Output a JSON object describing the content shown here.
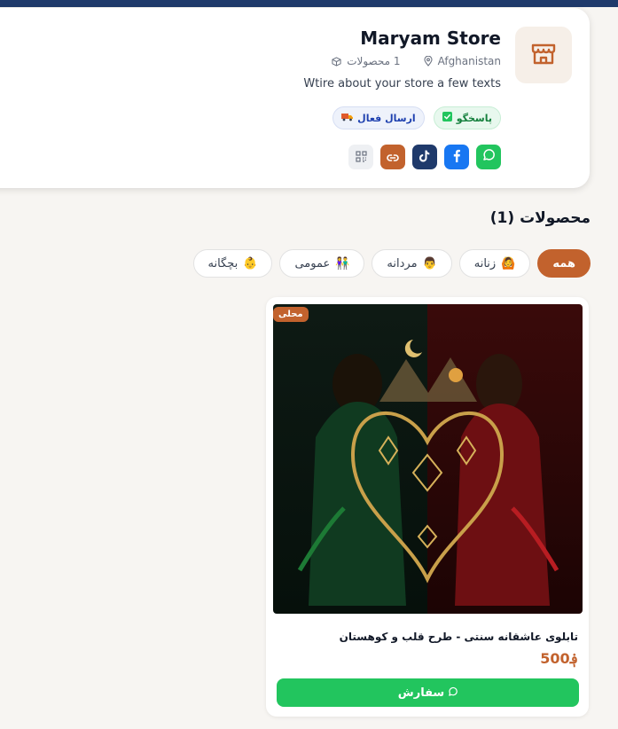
{
  "colors": {
    "accent": "#c2622d",
    "primary": "#1f3a6b",
    "success": "#22c55e"
  },
  "store": {
    "name": "Maryam Store",
    "location": "Afghanistan",
    "product_count": "1 محصولات",
    "description": "Wtire about your store a few texts",
    "badges": [
      {
        "icon": "check-box-icon",
        "label": "پاسخگو"
      },
      {
        "icon": "truck-icon",
        "label": "ارسال فعال"
      }
    ],
    "socials": [
      "whatsapp-icon",
      "facebook-icon",
      "tiktok-icon",
      "link-icon",
      "qr-code-icon"
    ]
  },
  "products_section": {
    "title": "محصولات (1)",
    "filters": [
      {
        "label": "همه",
        "icon": "",
        "active": true
      },
      {
        "label": "زنانه",
        "icon": "🙆",
        "active": false
      },
      {
        "label": "مردانه",
        "icon": "👨",
        "active": false
      },
      {
        "label": "عمومی",
        "icon": "👫",
        "active": false
      },
      {
        "label": "بچگانه",
        "icon": "👶",
        "active": false
      }
    ]
  },
  "product": {
    "tag": "محلی",
    "title": "تابلوی عاشقانه سنتی - طرح قلب و کوهستان",
    "price": "؋500",
    "order_label": "سفارش"
  }
}
